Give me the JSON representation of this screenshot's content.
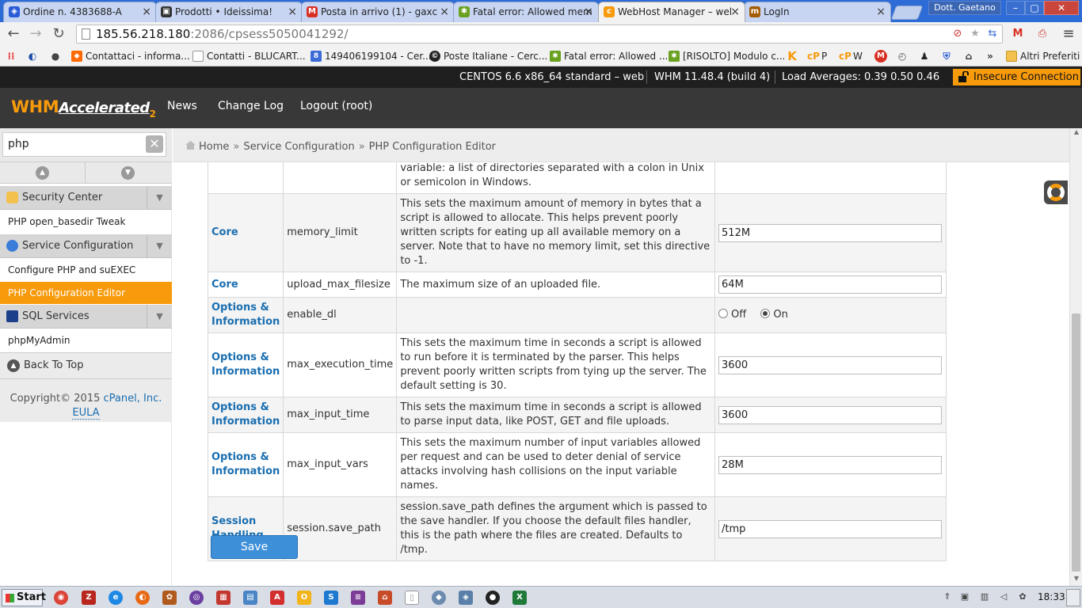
{
  "browser": {
    "tabs": [
      {
        "title": "Ordine n. 4383688-A",
        "favicon": "shield-icon",
        "color": "#2a5bd7"
      },
      {
        "title": "Prodotti • Ideissima!",
        "favicon": "bag-icon",
        "color": "#333333"
      },
      {
        "title": "Posta in arrivo (1) - gaxc",
        "favicon": "gmail-icon",
        "color": "#d93025"
      },
      {
        "title": "Fatal error: Allowed mem",
        "favicon": "bug-icon",
        "color": "#6aa121"
      },
      {
        "title": "WebHost Manager – wel",
        "favicon": "cpanel-icon",
        "color": "#f79a0b",
        "active": true
      },
      {
        "title": "LogIn",
        "favicon": "login-icon",
        "color": "#a35c00"
      }
    ],
    "close_glyph": "×",
    "user": "Dott. Gaetano",
    "window_controls": {
      "minimize": "–",
      "maximize": "▢",
      "close": "✕"
    },
    "nav": {
      "back": "←",
      "forward": "→",
      "reload": "↻"
    },
    "url_host": "185.56.218.180",
    "url_rest": ":2086/cpsess5050041292/",
    "menu_glyph": "≡",
    "bookmarks": [
      {
        "label": "Contattaci - informa...",
        "icon": "flame-icon",
        "color": "#ff6a00"
      },
      {
        "label": "Contatti - BLUCART...",
        "icon": "page-icon",
        "color": "#999999"
      },
      {
        "label": "149406199104 - Cer...",
        "icon": "search-icon",
        "color": "#3b6bd6"
      },
      {
        "label": "Poste Italiane - Cerc...",
        "icon": "globe-icon",
        "color": "#222222"
      },
      {
        "label": "Fatal error: Allowed ...",
        "icon": "bug-icon",
        "color": "#6aa121"
      },
      {
        "label": "[RISOLTO] Modulo c...",
        "icon": "bug-icon",
        "color": "#6aa121"
      },
      {
        "label": "P",
        "icon": "cpanel-icon",
        "color": "#f79a0b"
      },
      {
        "label": "W",
        "icon": "cpanel-icon",
        "color": "#f79a0b"
      }
    ],
    "bookmarks_more": "»",
    "bookmarks_other": "Altri Preferiti"
  },
  "whm": {
    "status": {
      "os": "CENTOS 6.6 x86_64 standard – web",
      "version": "WHM 11.48.4 (build 4)",
      "load": "Load Averages: 0.39 0.50 0.46",
      "insecure": "Insecure Connection"
    },
    "logo": {
      "main": "WHM",
      "accent": "Accelerated",
      "sub": "2"
    },
    "nav": {
      "news": "News",
      "changelog": "Change Log",
      "logout": "Logout (root)"
    },
    "sidebar": {
      "search_value": "php",
      "clear_glyph": "✕",
      "up_glyph": "▲",
      "down_glyph": "▼",
      "expand_glyph": "▼",
      "groups": {
        "security": "Security Center",
        "service": "Service Configuration",
        "sql": "SQL Services"
      },
      "links": {
        "open_basedir": "PHP open_basedir Tweak",
        "configure_php": "Configure PHP and suEXEC",
        "php_editor": "PHP Configuration Editor",
        "phpmyadmin": "phpMyAdmin"
      },
      "back_to_top": "Back To Top",
      "back_to_top_glyph": "▲",
      "copyright_prefix": "Copyright© 2015",
      "copyright_link": "cPanel, Inc.",
      "eula": "EULA"
    },
    "breadcrumb": {
      "home": "Home",
      "section": "Service Configuration",
      "page": "PHP Configuration Editor",
      "separator": "»"
    },
    "rows": [
      {
        "section": "",
        "directive": "",
        "desc": "variable: a list of directories separated with a colon in Unix or semicolon in Windows.",
        "value": "",
        "type": "none"
      },
      {
        "section": "Core",
        "directive": "memory_limit",
        "desc": "This sets the maximum amount of memory in bytes that a script is allowed to allocate. This helps prevent poorly written scripts for eating up all available memory on a server. Note that to have no memory limit, set this directive to -1.",
        "value": "512M",
        "type": "text"
      },
      {
        "section": "Core",
        "directive": "upload_max_filesize",
        "desc": "The maximum size of an uploaded file.",
        "value": "64M",
        "type": "text"
      },
      {
        "section": "Options & Information",
        "directive": "enable_dl",
        "desc": "",
        "value": "On",
        "type": "radio",
        "options": [
          "Off",
          "On"
        ]
      },
      {
        "section": "Options & Information",
        "directive": "max_execution_time",
        "desc": "This sets the maximum time in seconds a script is allowed to run before it is terminated by the parser. This helps prevent poorly written scripts from tying up the server. The default setting is 30.",
        "value": "3600",
        "type": "text"
      },
      {
        "section": "Options & Information",
        "directive": "max_input_time",
        "desc": "This sets the maximum time in seconds a script is allowed to parse input data, like POST, GET and file uploads.",
        "value": "3600",
        "type": "text"
      },
      {
        "section": "Options & Information",
        "directive": "max_input_vars",
        "desc": "This sets the maximum number of input variables allowed per request and can be used to deter denial of service attacks involving hash collisions on the input variable names.",
        "value": "28M",
        "type": "text"
      },
      {
        "section": "Session Handling",
        "directive": "session.save_path",
        "desc": "session.save_path defines the argument which is passed to the save handler. If you choose the default files handler, this is the path where the files are created. Defaults to /tmp.",
        "value": "/tmp",
        "type": "text"
      }
    ],
    "save_label": "Save"
  },
  "taskbar": {
    "start": "Start",
    "clock": "18:33",
    "tray_more": "⇑"
  }
}
